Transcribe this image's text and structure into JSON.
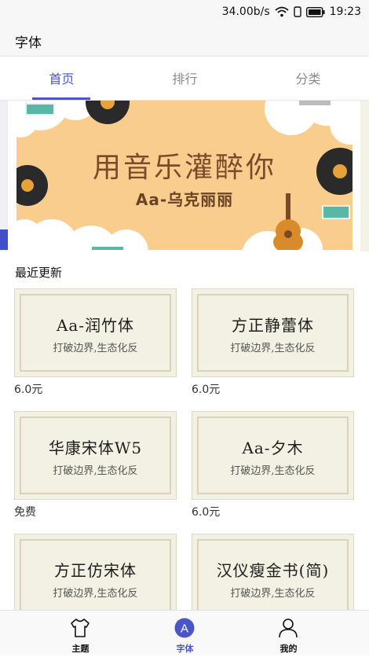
{
  "status_bar": {
    "speed": "34.00b/s",
    "time": "19:23"
  },
  "app_bar": {
    "title": "字体"
  },
  "tabs": [
    {
      "label": "首页",
      "active": true
    },
    {
      "label": "排行",
      "active": false
    },
    {
      "label": "分类",
      "active": false
    }
  ],
  "banner": {
    "title": "用音乐灌醉你",
    "subtitle": "Aa-乌克丽丽"
  },
  "section": {
    "title": "最近更新"
  },
  "fonts": [
    {
      "name": "Aa-润竹体",
      "sample": "打破边界,生态化反",
      "price": "6.0元"
    },
    {
      "name": "方正静蕾体",
      "sample": "打破边界,生态化反",
      "price": "6.0元"
    },
    {
      "name": "华康宋体W5",
      "sample": "打破边界,生态化反",
      "price": "免费"
    },
    {
      "name": "Aa-夕木",
      "sample": "打破边界,生态化反",
      "price": "6.0元"
    },
    {
      "name": "方正仿宋体",
      "sample": "打破边界,生态化反",
      "price": ""
    },
    {
      "name": "汉仪瘦金书(简)",
      "sample": "打破边界,生态化反",
      "price": ""
    }
  ],
  "bottom_nav": [
    {
      "label": "主题",
      "icon": "tshirt-icon",
      "active": false
    },
    {
      "label": "字体",
      "icon": "font-a-icon",
      "active": true
    },
    {
      "label": "我的",
      "icon": "person-icon",
      "active": false
    }
  ],
  "colors": {
    "accent": "#4a56c8",
    "banner_bg": "#f8cd8d",
    "card_bg": "#f3f1e3"
  }
}
